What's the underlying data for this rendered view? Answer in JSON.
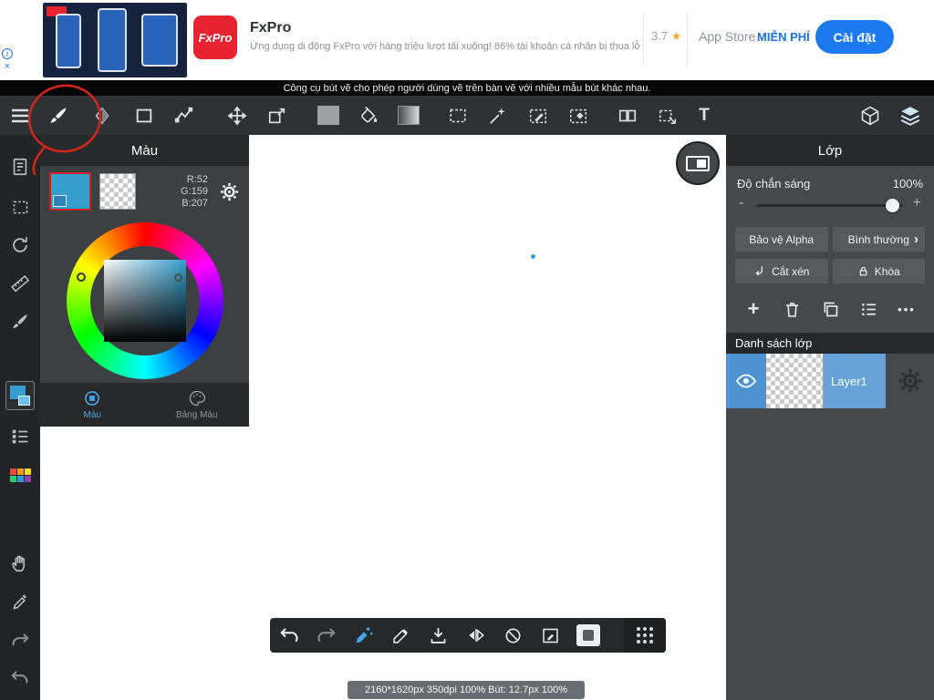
{
  "colors": {
    "fg_color": "#349FCF",
    "accent_blue": "#45A4E6",
    "install_blue": "#1B7AF0",
    "price_blue": "#1A73E8",
    "ad_red": "#E6232E",
    "star_yellow": "#F5A83C",
    "annotation_red": "#D2261B",
    "layer_blue": "#67A1D8",
    "layer_blue_dark": "#4F93D2"
  },
  "ad": {
    "info_icon": "i",
    "close_icon": "×",
    "logo_text": "FxPro",
    "app_name": "FxPro",
    "description": "Ứng dụng di động FxPro với hàng triệu lượt tải xuống! 86% tài khoản cá nhân bị thua lỗ",
    "rating": "3.7",
    "rating_star": "★",
    "store_label": "App Store",
    "price_label": "MIỄN PHÍ",
    "install_button": "Cài đặt"
  },
  "promo_strip": {
    "text": "Công cụ bút vẽ cho phép người dùng vẽ trên bàn vẽ với nhiều mẫu bút khác nhau."
  },
  "toolbar": {
    "text_tool_label": "T"
  },
  "color_panel": {
    "title": "Màu",
    "rgb_r": "R:52",
    "rgb_g": "G:159",
    "rgb_b": "B:207",
    "current_color": "#349FCF",
    "tab_color": "Màu",
    "tab_palette": "Bảng Màu"
  },
  "layers_panel": {
    "title": "Lớp",
    "opacity_label": "Độ chắn sáng",
    "opacity_value": "100%",
    "minus": "-",
    "plus": "+",
    "protect_alpha": "Bảo vệ Alpha",
    "blend_mode": "Bình thường",
    "blend_chevron": "›",
    "clip": "Cắt xén",
    "lock": "Khóa",
    "add_icon": "+",
    "more_icon": "•••",
    "list_title": "Danh sách lớp",
    "layers": [
      {
        "name": "Layer1"
      }
    ]
  },
  "status_bar": {
    "text": "2160*1620px 350dpi 100% Bút: 12.7px 100%"
  }
}
